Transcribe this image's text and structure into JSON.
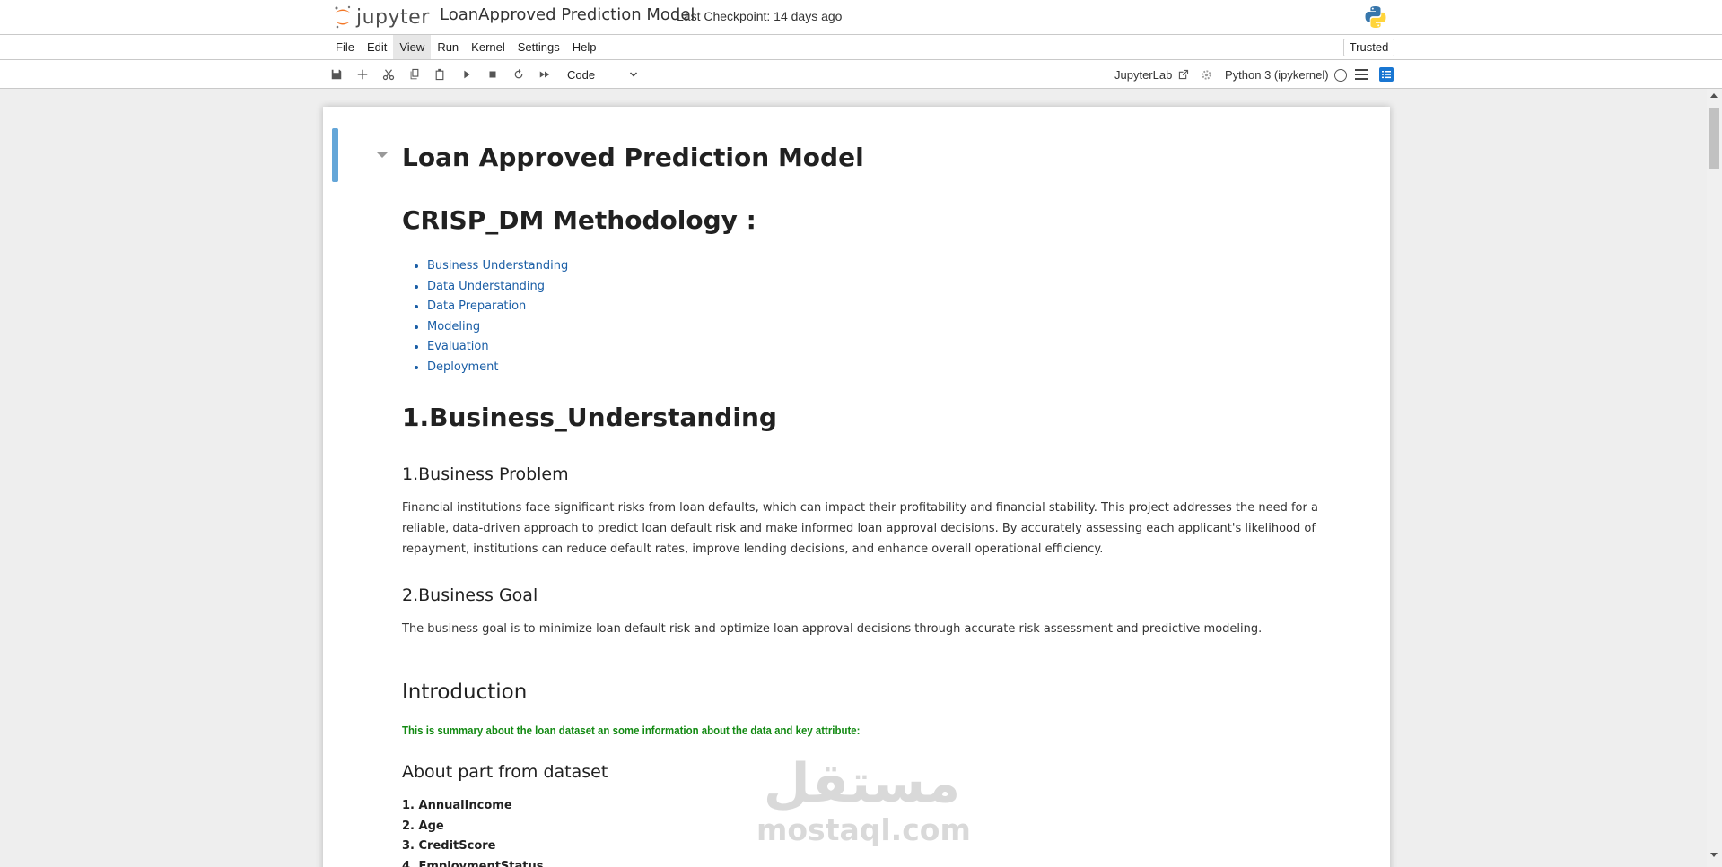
{
  "header": {
    "logo_text": "jupyter",
    "notebook_title": "LoanApproved Prediction Model",
    "checkpoint": "Last Checkpoint: 14 days ago"
  },
  "menu": {
    "items": [
      "File",
      "Edit",
      "View",
      "Run",
      "Kernel",
      "Settings",
      "Help"
    ],
    "active": "View",
    "trusted": "Trusted"
  },
  "toolbar": {
    "cell_type": "Code",
    "jupyterlab_label": "JupyterLab",
    "kernel": "Python 3 (ipykernel)",
    "icons": [
      "save-icon",
      "add-cell-icon",
      "cut-icon",
      "copy-icon",
      "paste-icon",
      "run-icon",
      "stop-icon",
      "restart-icon",
      "fast-forward-icon"
    ]
  },
  "notebook": {
    "title": "Loan Approved Prediction Model",
    "methodology_heading": "CRISP_DM Methodology :",
    "toc_links": [
      "Business Understanding",
      "Data Understanding",
      "Data Preparation",
      "Modeling",
      "Evaluation",
      "Deployment"
    ],
    "section1_heading": "1.Business_Understanding",
    "problem_heading": "1.Business Problem",
    "problem_text": "Financial institutions face significant risks from loan defaults, which can impact their profitability and financial stability. This project addresses the need for a reliable, data-driven approach to predict loan default risk and make informed loan approval decisions. By accurately assessing each applicant's likelihood of repayment, institutions can reduce default rates, improve lending decisions, and enhance overall operational efficiency.",
    "goal_heading": "2.Business Goal",
    "goal_text": "The business goal is to minimize loan default risk and optimize loan approval decisions through accurate risk assessment and predictive modeling.",
    "intro_heading": "Introduction",
    "intro_summary": "This is summary about the loan dataset an some information about the data and key attribute:",
    "about_heading": "About part from dataset",
    "attributes": [
      "1. AnnualIncome",
      "2. Age",
      "3. CreditScore",
      "4. EmploymentStatus"
    ]
  },
  "watermark": {
    "arabic": "مستقل",
    "latin": "mostaql.com"
  },
  "colors": {
    "link": "#1a5ea6",
    "summary_green": "#138a13",
    "cell_selected_bar": "#64a6d8",
    "toc_button": "#1976d2"
  }
}
